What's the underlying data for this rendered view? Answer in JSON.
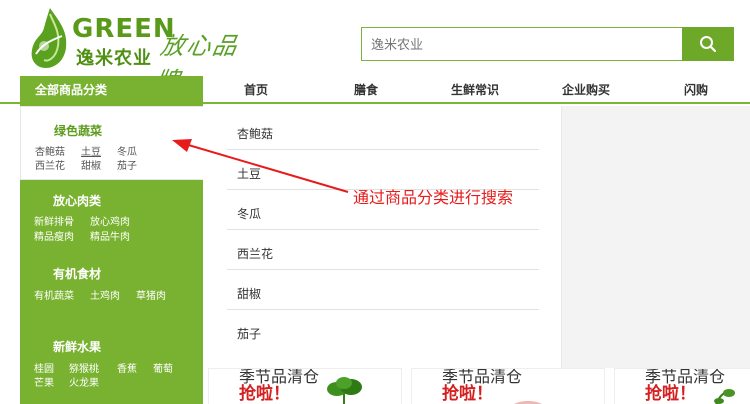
{
  "brand": {
    "logo_text": "GREEN",
    "logo_cn": "逸米农业",
    "slogan": "放心品牌"
  },
  "search": {
    "placeholder": "逸米农业",
    "icon": "search-icon"
  },
  "nav": {
    "all_categories": "全部商品分类",
    "items": [
      "首页",
      "膳食",
      "生鲜常识",
      "企业购买",
      "闪购"
    ]
  },
  "sidebar": {
    "categories": [
      {
        "title": "绿色蔬菜",
        "items": [
          "杏鲍菇",
          "土豆",
          "冬瓜",
          "西兰花",
          "甜椒",
          "茄子"
        ]
      },
      {
        "title": "放心肉类",
        "items": [
          "新鲜排骨",
          "放心鸡肉",
          "精品瘦肉",
          "精品牛肉"
        ]
      },
      {
        "title": "有机食材",
        "items": [
          "有机蔬菜",
          "土鸡肉",
          "草猪肉"
        ]
      },
      {
        "title": "新鲜水果",
        "items": [
          "桂圆",
          "猕猴桃",
          "香蕉",
          "葡萄",
          "芒果",
          "火龙果"
        ]
      }
    ]
  },
  "dropdown": {
    "items": [
      "杏鲍菇",
      "土豆",
      "冬瓜",
      "西兰花",
      "甜椒",
      "茄子"
    ]
  },
  "annotation": {
    "text": "通过商品分类进行搜索",
    "color": "#e81b1b"
  },
  "products": [
    {
      "title": "季节品清仓",
      "grab": "抢啦！"
    },
    {
      "title": "季节品清仓",
      "grab": "抢啦！"
    },
    {
      "title": "季节品清仓",
      "grab": "抢啦！"
    }
  ],
  "colors": {
    "brand_green": "#78b230",
    "accent_red": "#d42020"
  }
}
